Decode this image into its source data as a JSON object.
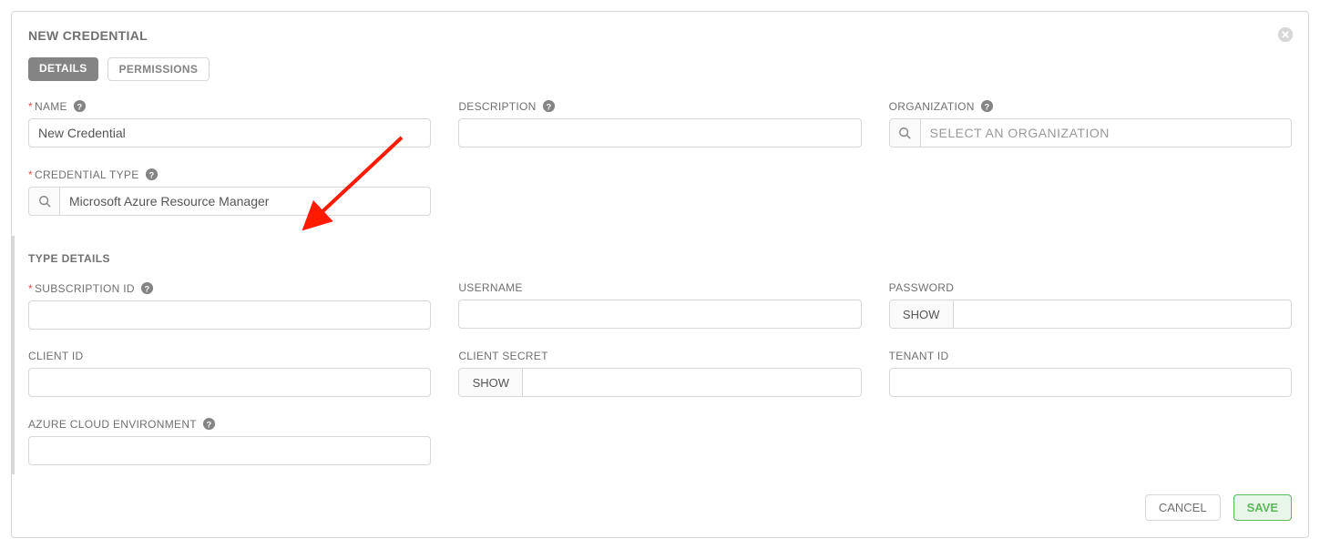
{
  "modal": {
    "title": "NEW CREDENTIAL"
  },
  "tabs": {
    "details": "DETAILS",
    "permissions": "PERMISSIONS"
  },
  "fields": {
    "name": {
      "label": "NAME",
      "value": "New Credential"
    },
    "description": {
      "label": "DESCRIPTION",
      "value": ""
    },
    "organization": {
      "label": "ORGANIZATION",
      "placeholder": "SELECT AN ORGANIZATION",
      "value": ""
    },
    "credential_type": {
      "label": "CREDENTIAL TYPE",
      "value": "Microsoft Azure Resource Manager"
    }
  },
  "type_details": {
    "heading": "TYPE DETAILS",
    "subscription_id": {
      "label": "SUBSCRIPTION ID",
      "value": ""
    },
    "username": {
      "label": "USERNAME",
      "value": ""
    },
    "password": {
      "label": "PASSWORD",
      "show": "SHOW",
      "value": ""
    },
    "client_id": {
      "label": "CLIENT ID",
      "value": ""
    },
    "client_secret": {
      "label": "CLIENT SECRET",
      "show": "SHOW",
      "value": ""
    },
    "tenant_id": {
      "label": "TENANT ID",
      "value": ""
    },
    "azure_cloud_env": {
      "label": "AZURE CLOUD ENVIRONMENT",
      "value": ""
    }
  },
  "footer": {
    "cancel": "CANCEL",
    "save": "SAVE"
  }
}
